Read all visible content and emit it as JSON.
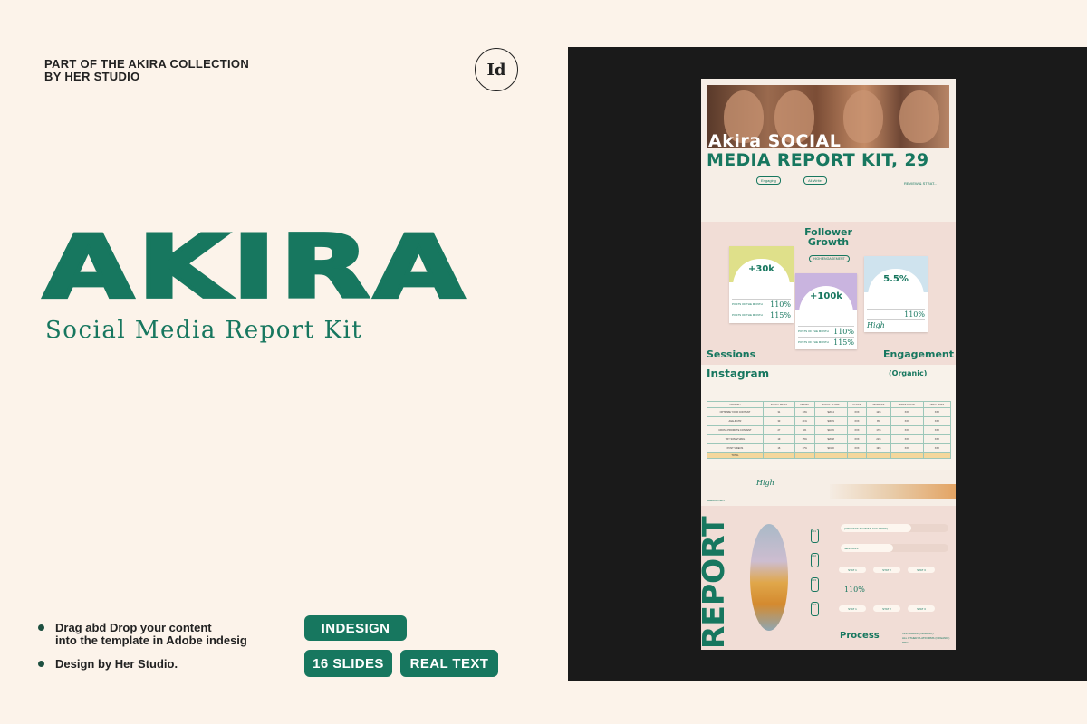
{
  "header": {
    "collection_line1": "PART OF THE AKIRA COLLECTION",
    "collection_line2": "BY HER STUDIO",
    "app_badge": "Id"
  },
  "hero": {
    "title": "AKIRA",
    "subtitle": "Social Media Report Kit"
  },
  "features": [
    {
      "text_line1": "Drag abd Drop your content",
      "text_line2": "into the template in Adobe indesig"
    },
    {
      "text_line1": "Design by Her Studio.",
      "text_line2": ""
    }
  ],
  "tags": [
    "INDESIGN",
    "16 SLIDES",
    "REAL TEXT"
  ],
  "colors": {
    "brand": "#17775f",
    "background": "#fcf3ea",
    "panel": "#1a1a1a",
    "pink": "#f1ddd6"
  },
  "preview": {
    "page1": {
      "title_line1": "Akira SOCIAL",
      "title_line2": "MEDIA REPORT KIT, 29",
      "pill1": "Engaging",
      "pill2": "All Writer",
      "link": "REVIEW & STRAT..."
    },
    "page2": {
      "heading_line1": "Follower",
      "heading_line2": "Growth",
      "pill": "HIGH ENGAGEMENT",
      "cards": [
        {
          "value": "+30k",
          "rows": [
            {
              "label": "POSTS OF THE MONTH",
              "value": "110%"
            },
            {
              "label": "POSTS OF THE MONTH",
              "value": "115%"
            }
          ],
          "color": "#dfe08a"
        },
        {
          "value": "+100k",
          "rows": [
            {
              "label": "POSTS OF THE MONTH",
              "value": "110%"
            },
            {
              "label": "POSTS OF THE MONTH",
              "value": "115%"
            }
          ],
          "color": "#c9b4df"
        },
        {
          "value": "5.5%",
          "rows": [
            {
              "label": "",
              "value": "110%"
            },
            {
              "label": "High",
              "value": ""
            }
          ],
          "color": "#cfe3ee"
        }
      ],
      "left_label": "Sessions",
      "right_label": "Engagement"
    },
    "page3": {
      "heading": "Instagram",
      "subheading": "(Organic)",
      "table_headers": [
        "GROWTH",
        "SOCIAL MEDIA",
        "MONTH",
        "SOCIAL SHARE",
        "CLICKS",
        "RETWEET",
        "POSTS SOCIAL",
        "VIRAL POST"
      ],
      "table_rows": [
        [
          "OPTIMIZE YOUR CONTENT",
          "31",
          "13%",
          "$2014",
          "XXX",
          "12%",
          "XXX",
          "XXX"
        ],
        [
          "AGE & CTR",
          "33",
          "21%",
          "$3029",
          "XXX",
          "8%",
          "XXX",
          "XXX"
        ],
        [
          "CROSS PROMOTE CONTENT",
          "27",
          "9%",
          "$1055",
          "XXX",
          "17%",
          "XXX",
          "XXX"
        ],
        [
          "TRY SOMETHING",
          "19",
          "15%",
          "$2088",
          "XXX",
          "21%",
          "XXX",
          "XXX"
        ],
        [
          "POST VIDEOS",
          "16",
          "17%",
          "$1990",
          "XXX",
          "19%",
          "XXX",
          "XXX"
        ]
      ],
      "total_label": "TOTAL",
      "high_label": "High",
      "breakdown_label": "BREAKDOWN"
    },
    "page4": {
      "vertical_title": "REPORT",
      "side_numbers": [
        "001",
        "002",
        "003",
        "004",
        "005"
      ],
      "bars": [
        {
          "label": "(UPGRADE TO PRIVILEGE MODE)",
          "value": "128",
          "fraction": 0.62
        },
        {
          "label": "SESSIONS",
          "value": "150",
          "fraction": 0.45
        }
      ],
      "stat_pills": [
        "STAT 1",
        "STAT 2",
        "STAT 3"
      ],
      "percent": "110%",
      "percent_value": "1000",
      "stat_pills2": [
        "STAT 1",
        "STAT 2",
        "STAT 3"
      ],
      "heading": "Process",
      "process_tags": [
        "INSTAGRAM (ORGANIC)",
        "ALL OTHER PLATFORMS (ORGANIC)",
        "PRO"
      ]
    }
  }
}
